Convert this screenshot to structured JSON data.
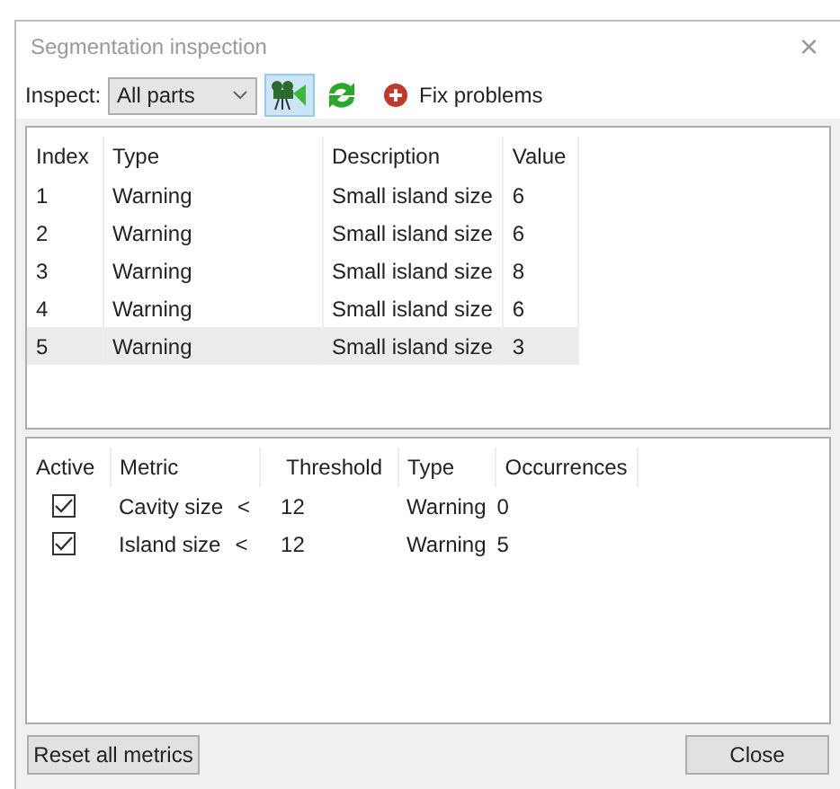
{
  "window": {
    "title": "Segmentation inspection",
    "close": "×"
  },
  "toolbar": {
    "inspect_label": "Inspect:",
    "inspect_value": "All parts",
    "camera_pressed": true,
    "fix_button": "Fix problems"
  },
  "issues": {
    "columns": [
      "Index",
      "Type",
      "Description",
      "Value"
    ],
    "rows": [
      {
        "cells": [
          "1",
          "Warning",
          "Small island size",
          "6"
        ],
        "selected": false
      },
      {
        "cells": [
          "2",
          "Warning",
          "Small island size",
          "6"
        ],
        "selected": false
      },
      {
        "cells": [
          "3",
          "Warning",
          "Small island size",
          "8"
        ],
        "selected": false
      },
      {
        "cells": [
          "4",
          "Warning",
          "Small island size",
          "6"
        ],
        "selected": false
      },
      {
        "cells": [
          "5",
          "Warning",
          "Small island size",
          "3"
        ],
        "selected": true
      }
    ]
  },
  "metrics": {
    "columns": [
      "Active",
      "Metric",
      "Threshold",
      "Type",
      "Occurrences"
    ],
    "rows": [
      {
        "checked": true,
        "metric": "Cavity size",
        "comparator": "<",
        "threshold": "12",
        "type": "Warning",
        "occurrences": "0"
      },
      {
        "checked": true,
        "metric": "Island size",
        "comparator": "<",
        "threshold": "12",
        "type": "Warning",
        "occurrences": "5"
      }
    ]
  },
  "buttons": {
    "reset": "Reset all metrics",
    "close": "Close"
  }
}
